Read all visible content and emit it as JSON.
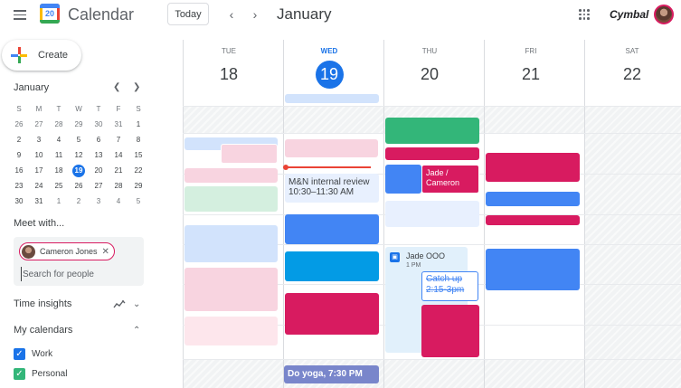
{
  "header": {
    "app_title": "Calendar",
    "logo_day": "20",
    "today_label": "Today",
    "prev_icon": "chevron-left-icon",
    "next_icon": "chevron-right-icon",
    "month_title": "January",
    "apps_icon": "apps-grid-icon",
    "brand": "Cymbal"
  },
  "sidebar": {
    "create_label": "Create",
    "mini_calendar": {
      "month": "January",
      "weekday_headers": [
        "S",
        "M",
        "T",
        "W",
        "T",
        "F",
        "S"
      ],
      "weeks": [
        [
          "26",
          "27",
          "28",
          "29",
          "30",
          "31",
          "1"
        ],
        [
          "2",
          "3",
          "4",
          "5",
          "6",
          "7",
          "8"
        ],
        [
          "9",
          "10",
          "11",
          "12",
          "13",
          "14",
          "15"
        ],
        [
          "16",
          "17",
          "18",
          "19",
          "20",
          "21",
          "22"
        ],
        [
          "23",
          "24",
          "25",
          "26",
          "27",
          "28",
          "29"
        ],
        [
          "30",
          "31",
          "1",
          "2",
          "3",
          "4",
          "5"
        ]
      ],
      "selected": "19"
    },
    "meet_with": {
      "title": "Meet with...",
      "chip_name": "Cameron Jones",
      "search_placeholder": "Search for people"
    },
    "time_insights": "Time insights",
    "my_calendars": {
      "title": "My calendars",
      "items": [
        {
          "label": "Work",
          "color": "#1a73e8"
        },
        {
          "label": "Personal",
          "color": "#33b679"
        }
      ]
    }
  },
  "days": [
    {
      "dow": "TUE",
      "num": "18",
      "today": false
    },
    {
      "dow": "WED",
      "num": "19",
      "today": true
    },
    {
      "dow": "THU",
      "num": "20",
      "today": false
    },
    {
      "dow": "FRI",
      "num": "21",
      "today": false
    },
    {
      "dow": "SAT",
      "num": "22",
      "today": false
    }
  ],
  "events": {
    "mn_review_title": "M&N internal review",
    "mn_review_time": "10:30–11:30 AM",
    "jade_cameron": "Jade / Cameron",
    "jade_ooo_title": "Jade OOO",
    "jade_ooo_time": "1 PM",
    "catch_up": "Catch up",
    "catch_up_time": "2:15-3pm",
    "yoga": "Do yoga, 7:30 PM"
  },
  "colors": {
    "blue": "#4285f4",
    "light_blue": "#d2e3fc",
    "pink": "#d81b60",
    "light_pink": "#f8d4e0",
    "green": "#33b679",
    "light_green": "#d4efdf",
    "cyan": "#039be5",
    "lavender": "#7986cb",
    "ooo_blue": "#e1f0fb"
  }
}
